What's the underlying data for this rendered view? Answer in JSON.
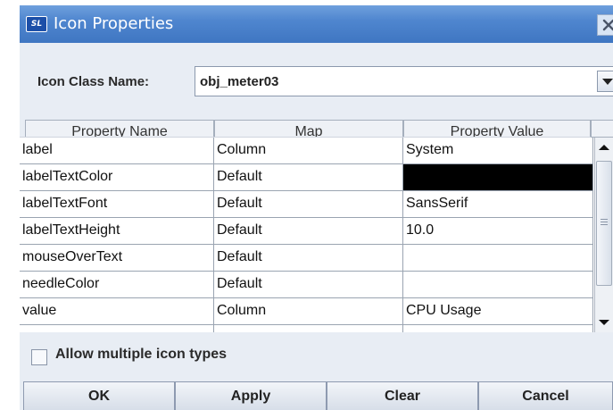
{
  "window": {
    "title": "Icon Properties",
    "app_icon_text": "SL"
  },
  "icon_class": {
    "label": "Icon Class Name:",
    "value": "obj_meter03"
  },
  "table": {
    "columns": [
      "Property Name",
      "Map",
      "Property Value"
    ],
    "rows": [
      {
        "name": "label",
        "map": "Column",
        "value": "System"
      },
      {
        "name": "labelTextColor",
        "map": "Default",
        "value": "",
        "color": "#000000"
      },
      {
        "name": "labelTextFont",
        "map": "Default",
        "value": "SansSerif"
      },
      {
        "name": "labelTextHeight",
        "map": "Default",
        "value": "10.0"
      },
      {
        "name": "mouseOverText",
        "map": "Default",
        "value": ""
      },
      {
        "name": "needleColor",
        "map": "Default",
        "value": ""
      },
      {
        "name": "value",
        "map": "Column",
        "value": "CPU Usage"
      }
    ]
  },
  "options": {
    "allow_multiple_label": "Allow multiple icon types",
    "allow_multiple_checked": false
  },
  "buttons": {
    "ok": "OK",
    "apply": "Apply",
    "clear": "Clear",
    "cancel": "Cancel"
  },
  "colors": {
    "title_bar": "#4f86cf",
    "dialog_bg": "#e8edf4",
    "swatch": "#000000"
  },
  "icons": {
    "app": "sl-logo-icon",
    "close": "close-icon",
    "dropdown": "chevron-down-icon",
    "scroll_up": "scroll-up-icon",
    "scroll_down": "scroll-down-icon"
  }
}
